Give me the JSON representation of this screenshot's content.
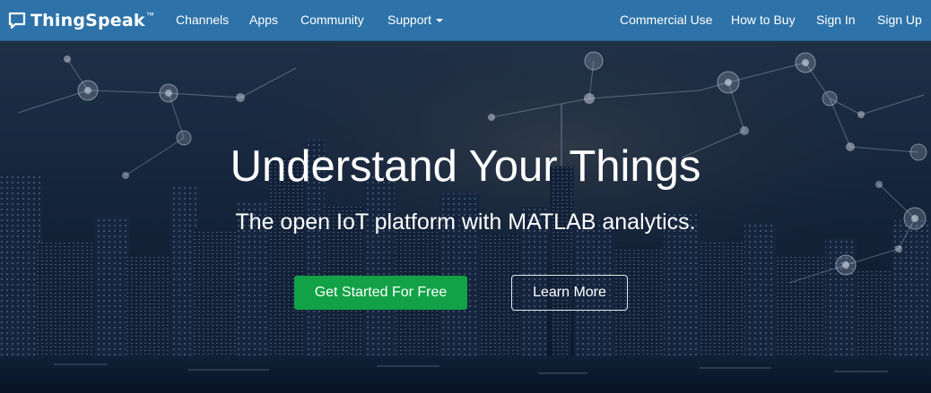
{
  "brand": {
    "name": "ThingSpeak",
    "trademark": "™",
    "icon": "chat-bubble-icon"
  },
  "nav_left": [
    {
      "label": "Channels"
    },
    {
      "label": "Apps"
    },
    {
      "label": "Community"
    },
    {
      "label": "Support",
      "has_dropdown": true
    }
  ],
  "nav_right": [
    {
      "label": "Commercial Use"
    },
    {
      "label": "How to Buy"
    },
    {
      "label": "Sign In"
    },
    {
      "label": "Sign Up"
    }
  ],
  "hero": {
    "headline": "Understand Your Things",
    "subheadline": "The open IoT platform with MATLAB analytics.",
    "primary_button": "Get Started For Free",
    "secondary_button": "Learn More"
  },
  "colors": {
    "navbar": "#2d72a8",
    "primary_button": "#12a147",
    "hero_sky_top": "#1b2d45",
    "hero_dark": "#0a1626"
  }
}
